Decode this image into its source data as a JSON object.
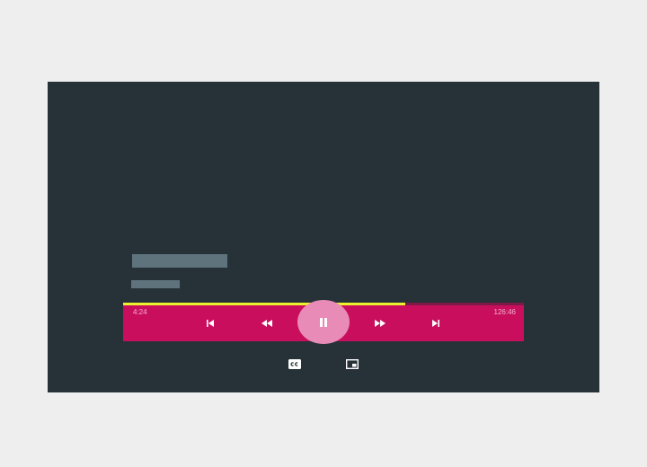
{
  "player": {
    "elapsed_time": "4:24",
    "total_time": "126:46",
    "progress_fraction": 0.703
  },
  "colors": {
    "page_background": "#eeeeee",
    "screen_background": "#263238",
    "placeholder": "#5f737d",
    "control_bar": "#c90e5e",
    "progress_fill": "#e9f22d",
    "play_highlight": "#e88bb6"
  },
  "icons": {
    "skip_previous": "skip-previous-icon",
    "rewind": "rewind-icon",
    "pause": "pause-icon",
    "fast_forward": "fast-forward-icon",
    "skip_next": "skip-next-icon",
    "closed_captions": "closed-captions-icon",
    "picture_in_picture": "picture-in-picture-icon"
  }
}
